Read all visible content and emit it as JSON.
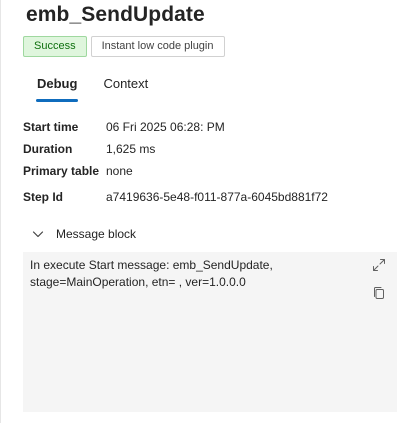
{
  "header": {
    "title": "emb_SendUpdate",
    "badges": {
      "status": "Success",
      "type": "Instant low code plugin"
    }
  },
  "tabs": [
    {
      "label": "Debug",
      "active": true
    },
    {
      "label": "Context",
      "active": false
    }
  ],
  "properties": [
    {
      "label": "Start time",
      "value": "06 Fri 2025 06:28: PM"
    },
    {
      "label": "Duration",
      "value": "1,625 ms"
    },
    {
      "label": "Primary table",
      "value": "none"
    },
    {
      "label": "Step Id",
      "value": "a7419636-5e48-f011-877a-6045bd881f72"
    }
  ],
  "message_block": {
    "label": "Message block",
    "expanded": true,
    "text": "In execute Start message: emb_SendUpdate,\nstage=MainOperation, etn= , ver=1.0.0.0",
    "icons": [
      "expand-icon",
      "copy-icon"
    ]
  },
  "colors": {
    "accent": "#0f6cbd",
    "success_bg": "#dff6dd",
    "success_text": "#0e700e",
    "message_bg": "#f5f5f5"
  }
}
